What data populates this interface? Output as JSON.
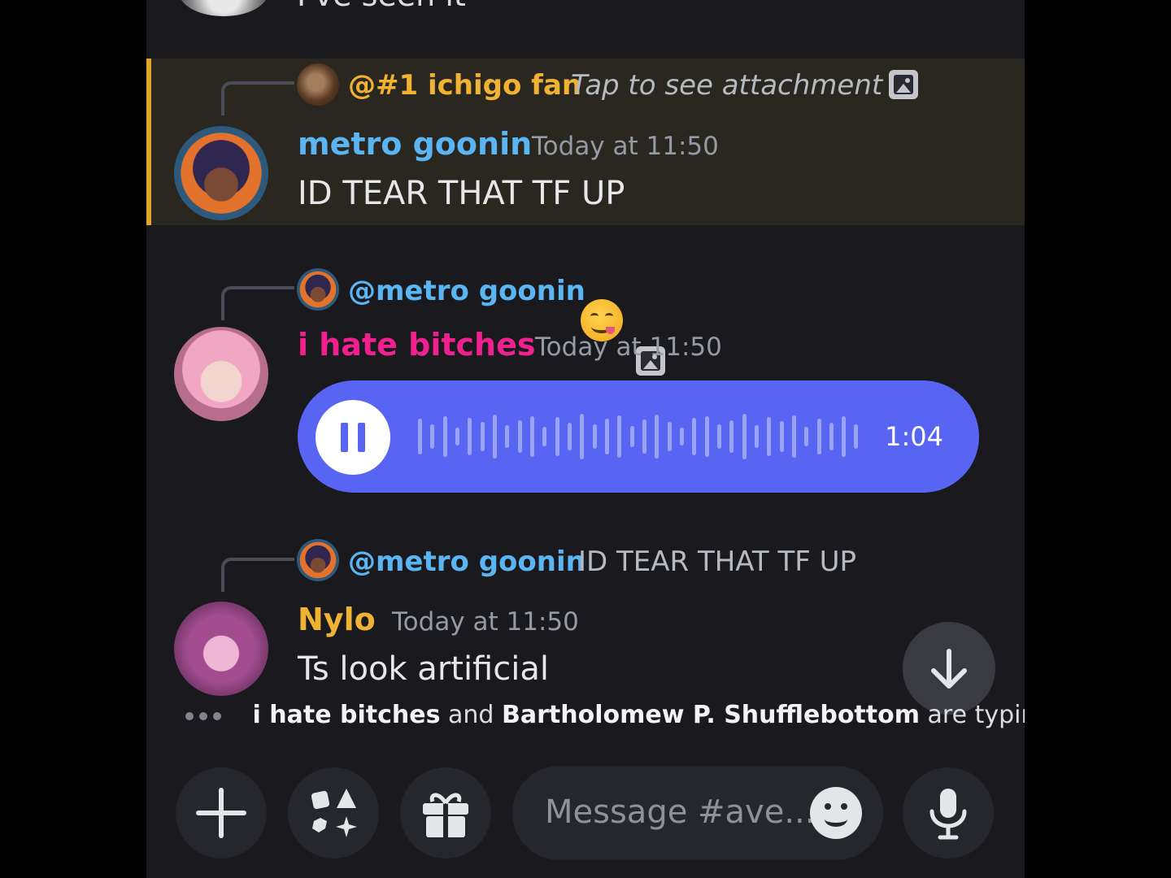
{
  "top": {
    "partial_text": "I've seen it"
  },
  "messages": [
    {
      "reply": {
        "name": "@#1 ichigo fan",
        "text": "Tap to see attachment"
      },
      "author": "metro goonin",
      "timestamp": "Today at 11:50",
      "text": "ID TEAR THAT TF UP"
    },
    {
      "reply": {
        "name": "@metro goonin"
      },
      "author": "i hate bitches",
      "timestamp": "Today at 11:50",
      "voice": {
        "duration": "1:04"
      }
    },
    {
      "reply": {
        "name": "@metro goonin",
        "text": "ID TEAR THAT TF UP"
      },
      "author": "Nylo",
      "timestamp": "Today at 11:50",
      "text": "Ts look artificial"
    }
  ],
  "typing": {
    "user1": "i hate bitches",
    "joiner": "and",
    "user2": "Bartholomew P. Shufflebottom",
    "suffix": "are typing..."
  },
  "composer": {
    "placeholder": "Message #ave..."
  },
  "icons": {
    "attach": "plus-icon",
    "apps": "apps-icon",
    "gift": "gift-icon",
    "emoji": "emoji-icon",
    "voice": "microphone-icon",
    "scroll": "arrow-down-icon"
  },
  "colors": {
    "highlight_bar": "#e0a626",
    "voice_bubble": "#5865f2",
    "author_blue": "#5ab5f2",
    "author_pink": "#f0208f",
    "author_gold": "#f0b232"
  }
}
